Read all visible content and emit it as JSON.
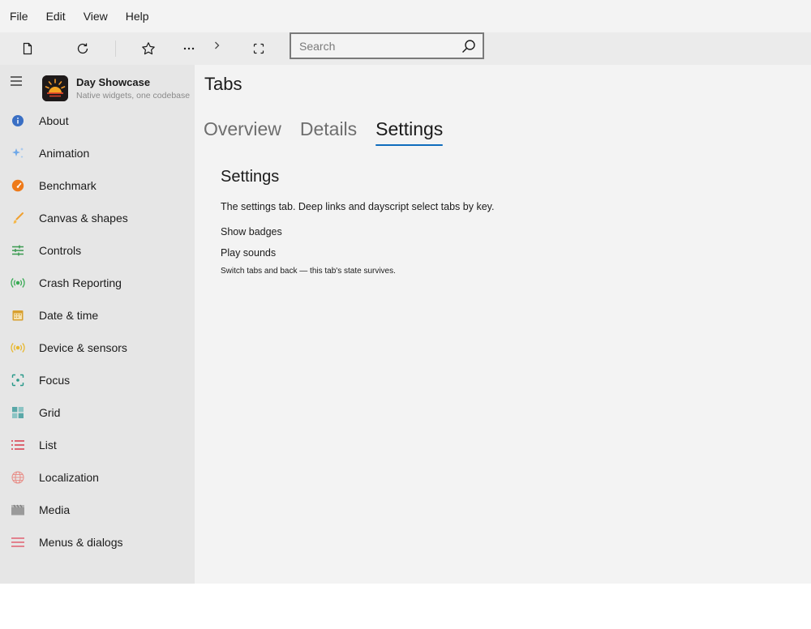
{
  "menubar": {
    "items": [
      "File",
      "Edit",
      "View",
      "Help"
    ]
  },
  "toolbar": {
    "buttons": [
      "new-file-icon",
      "refresh-icon",
      "star-icon",
      "more-icon",
      "chevron-right-icon",
      "fullscreen-icon"
    ],
    "search_placeholder": "Search"
  },
  "sidebar": {
    "brand": {
      "title": "Day Showcase",
      "subtitle": "Native widgets, one codebase"
    },
    "items": [
      {
        "label": "About",
        "icon": "info-icon",
        "color": "#3a6fc4"
      },
      {
        "label": "Animation",
        "icon": "sparkle-icon",
        "color": "#6fa8e8"
      },
      {
        "label": "Benchmark",
        "icon": "gauge-icon",
        "color": "#ee7a1a"
      },
      {
        "label": "Canvas & shapes",
        "icon": "brush-icon",
        "color": "#f0a030"
      },
      {
        "label": "Controls",
        "icon": "sliders-icon",
        "color": "#3a9a50"
      },
      {
        "label": "Crash Reporting",
        "icon": "broadcast-icon",
        "color": "#3aaa55"
      },
      {
        "label": "Date & time",
        "icon": "calendar-icon",
        "color": "#d8a030"
      },
      {
        "label": "Device & sensors",
        "icon": "sensor-icon",
        "color": "#e8b830"
      },
      {
        "label": "Focus",
        "icon": "focus-icon",
        "color": "#2a9a8a"
      },
      {
        "label": "Grid",
        "icon": "grid-icon",
        "color": "#5aa8a8"
      },
      {
        "label": "List",
        "icon": "list-icon",
        "color": "#d83a4a"
      },
      {
        "label": "Localization",
        "icon": "globe-icon",
        "color": "#e8908a"
      },
      {
        "label": "Media",
        "icon": "clapper-icon",
        "color": "#9a9a9a"
      },
      {
        "label": "Menus & dialogs",
        "icon": "menu-icon",
        "color": "#e06070"
      }
    ]
  },
  "main": {
    "title": "Tabs",
    "tabs": [
      {
        "label": "Overview",
        "active": false
      },
      {
        "label": "Details",
        "active": false
      },
      {
        "label": "Settings",
        "active": true
      }
    ],
    "panel": {
      "title": "Settings",
      "description": "The settings tab. Deep links and dayscript select tabs by key.",
      "toggles": [
        "Show badges",
        "Play sounds"
      ],
      "note": "Switch tabs and back — this tab's state survives."
    },
    "accent_color": "#0f6cbd"
  }
}
